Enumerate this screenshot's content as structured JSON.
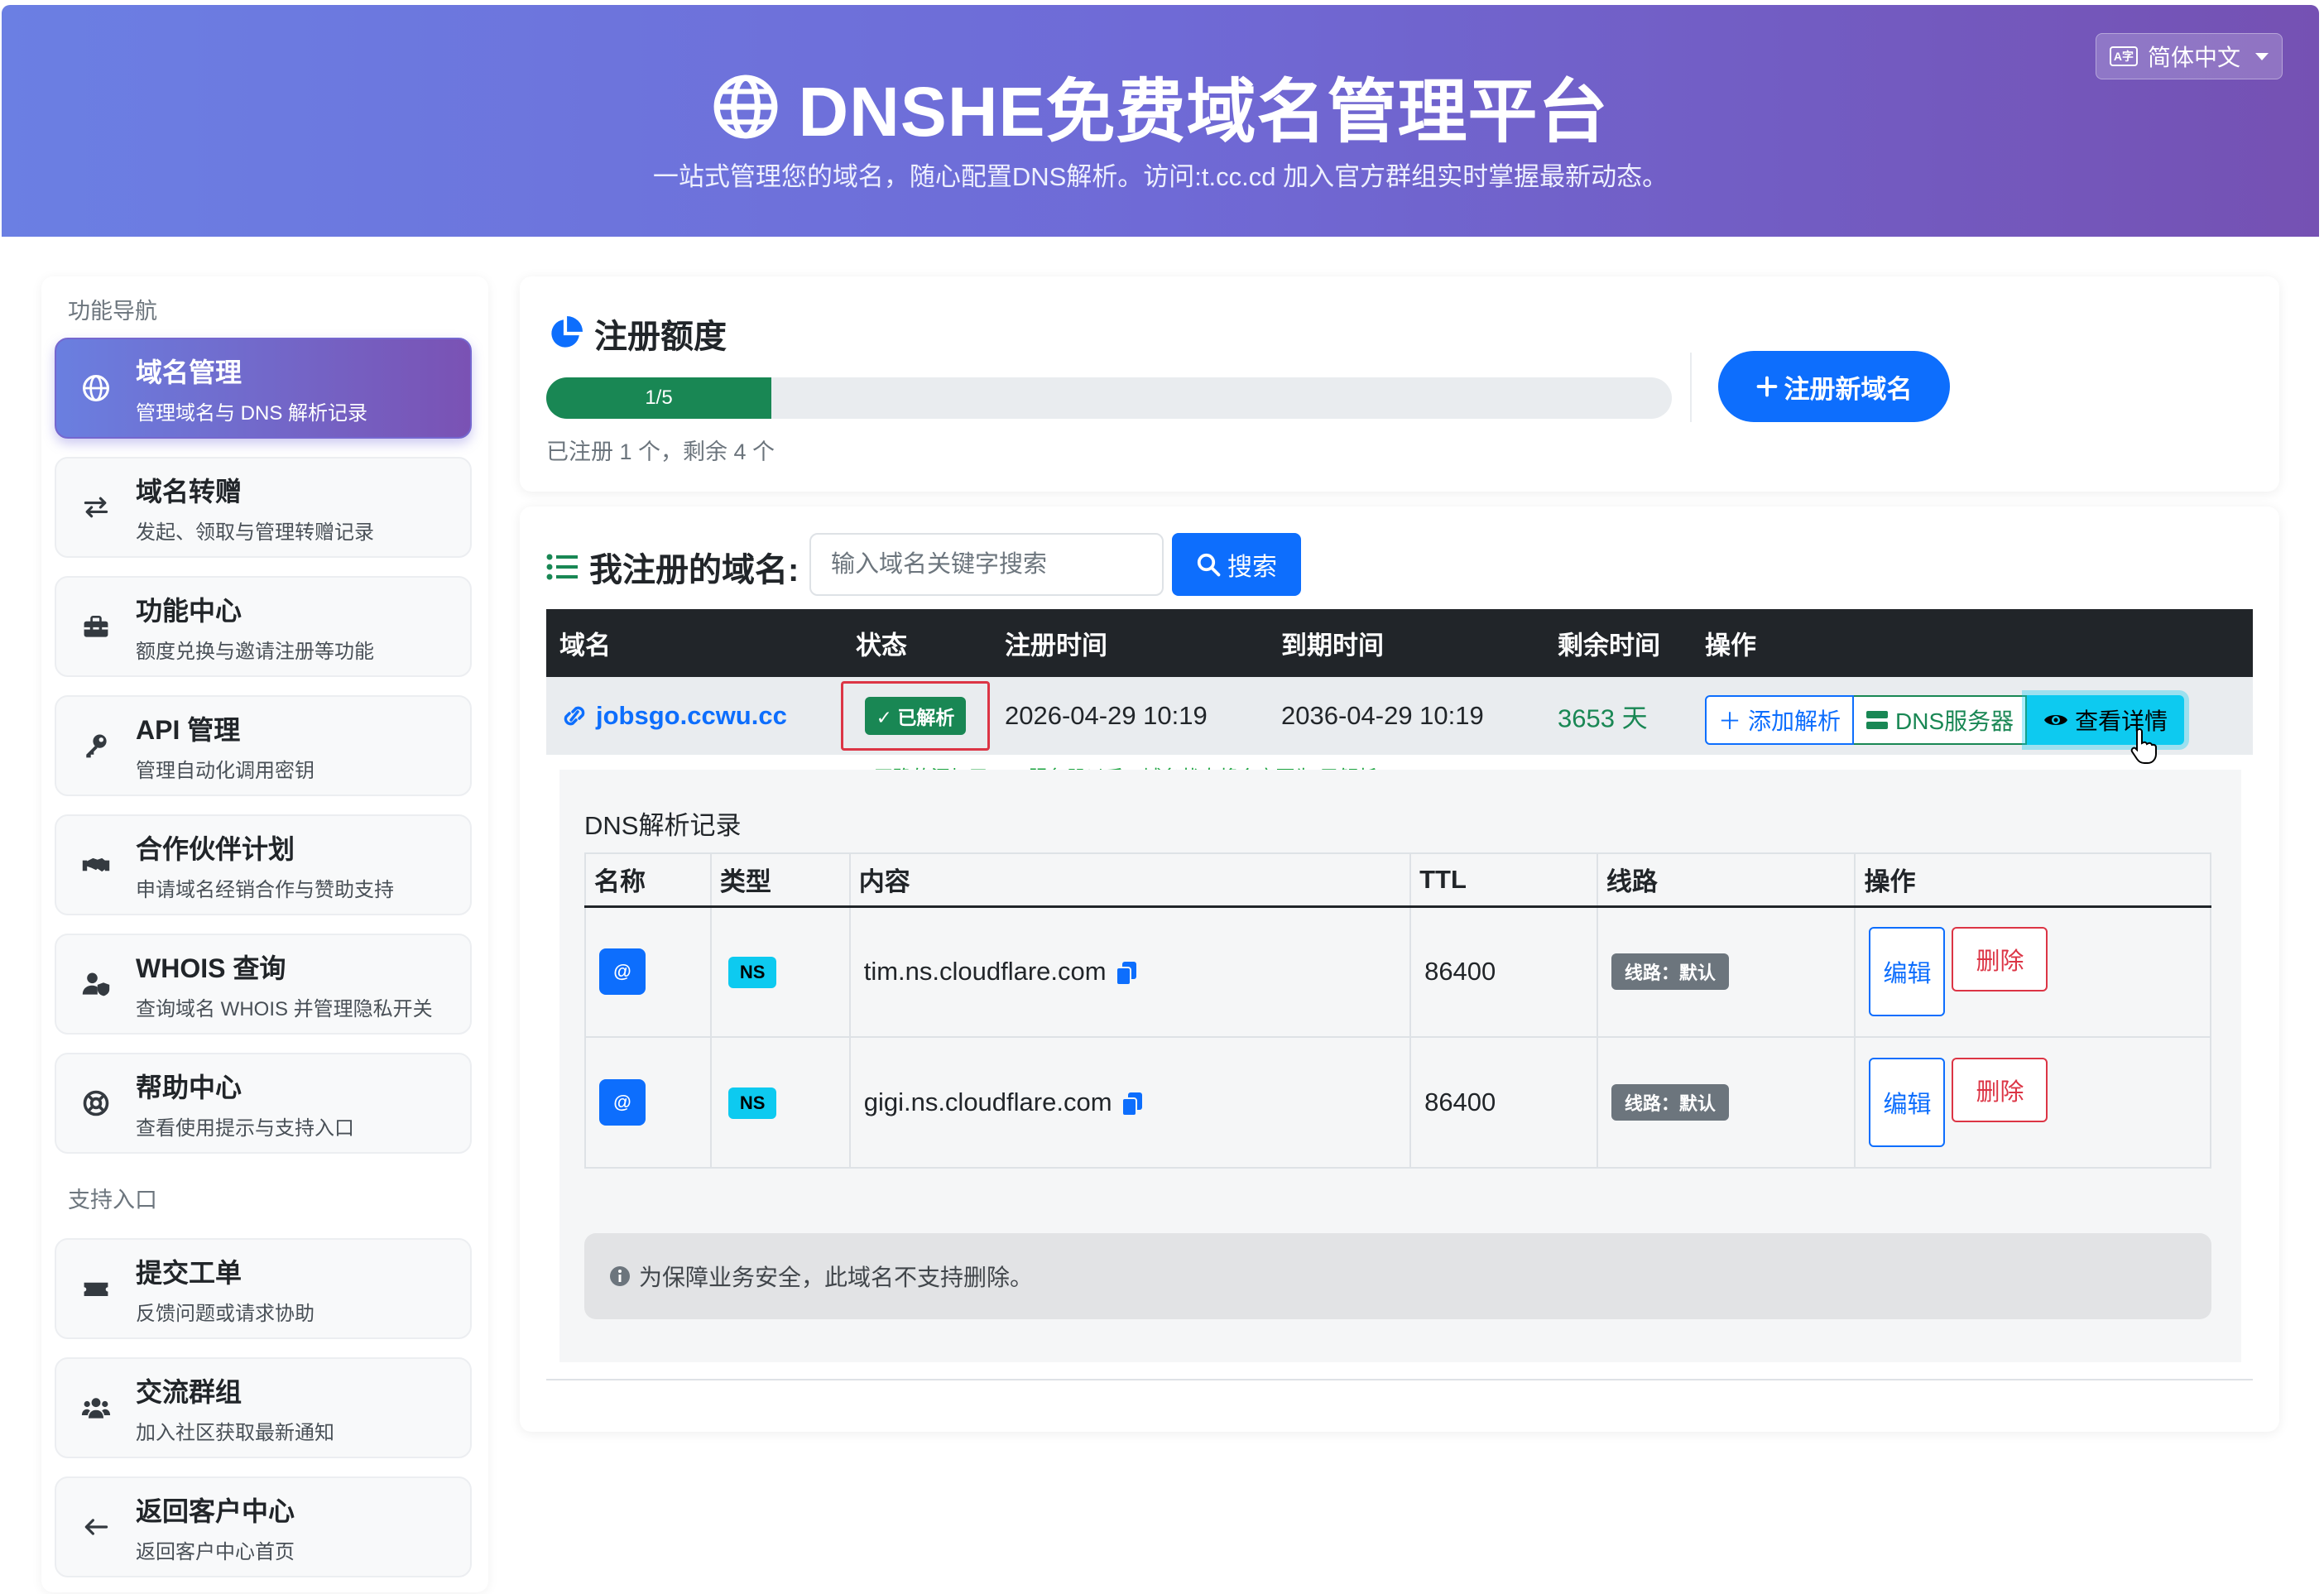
{
  "header": {
    "title": "DNSHE免费域名管理平台",
    "subtitle": "一站式管理您的域名，随心配置DNS解析。访问:t.cc.cd 加入官方群组实时掌握最新动态。",
    "language": "简体中文"
  },
  "sidebar": {
    "section_nav": "功能导航",
    "section_support": "支持入口",
    "items": [
      {
        "title": "域名管理",
        "desc": "管理域名与 DNS 解析记录",
        "icon": "globe-icon"
      },
      {
        "title": "域名转赠",
        "desc": "发起、领取与管理转赠记录",
        "icon": "exchange-icon"
      },
      {
        "title": "功能中心",
        "desc": "额度兑换与邀请注册等功能",
        "icon": "toolbox-icon"
      },
      {
        "title": "API 管理",
        "desc": "管理自动化调用密钥",
        "icon": "key-icon"
      },
      {
        "title": "合作伙伴计划",
        "desc": "申请域名经销合作与赞助支持",
        "icon": "handshake-icon"
      },
      {
        "title": "WHOIS 查询",
        "desc": "查询域名 WHOIS 并管理隐私开关",
        "icon": "user-shield-icon"
      },
      {
        "title": "帮助中心",
        "desc": "查看使用提示与支持入口",
        "icon": "lifebuoy-icon"
      }
    ],
    "support_items": [
      {
        "title": "提交工单",
        "desc": "反馈问题或请求协助",
        "icon": "ticket-icon"
      },
      {
        "title": "交流群组",
        "desc": "加入社区获取最新通知",
        "icon": "users-icon"
      },
      {
        "title": "返回客户中心",
        "desc": "返回客户中心首页",
        "icon": "arrow-left-icon"
      }
    ]
  },
  "quota": {
    "title": "注册额度",
    "progress_label": "1/5",
    "progress_fraction": 0.2,
    "summary": "已注册 1 个，剩余 4 个",
    "register_button": "注册新域名"
  },
  "domains": {
    "title": "我注册的域名:",
    "search_placeholder": "输入域名关键字搜索",
    "search_button": "搜索",
    "columns": [
      "域名",
      "状态",
      "注册时间",
      "到期时间",
      "剩余时间",
      "操作"
    ],
    "row": {
      "domain": "jobsgo.ccwu.cc",
      "status": "已解析",
      "registered": "2026-04-29 10:19",
      "expires": "2036-04-29 10:19",
      "remaining": "3653 天",
      "actions": [
        "添加解析",
        "DNS服务器",
        "查看详情"
      ]
    },
    "annotation": "正确的添加了DNS服务器以后，域名状态将会变更为“已解析”"
  },
  "dns": {
    "title": "DNS解析记录",
    "columns": [
      "名称",
      "类型",
      "内容",
      "TTL",
      "线路",
      "操作"
    ],
    "records": [
      {
        "name": "@",
        "type": "NS",
        "content": "tim.ns.cloudflare.com",
        "ttl": "86400",
        "line": "线路：默认",
        "edit": "编辑",
        "delete": "删除"
      },
      {
        "name": "@",
        "type": "NS",
        "content": "gigi.ns.cloudflare.com",
        "ttl": "86400",
        "line": "线路：默认",
        "edit": "编辑",
        "delete": "删除"
      }
    ],
    "notice": "为保障业务安全，此域名不支持删除。"
  },
  "colors": {
    "primary": "#0d6efd",
    "success": "#198754",
    "info": "#0dcaf0",
    "danger": "#dc3545",
    "header_from": "#6b7fe3",
    "header_to": "#7551b3"
  }
}
